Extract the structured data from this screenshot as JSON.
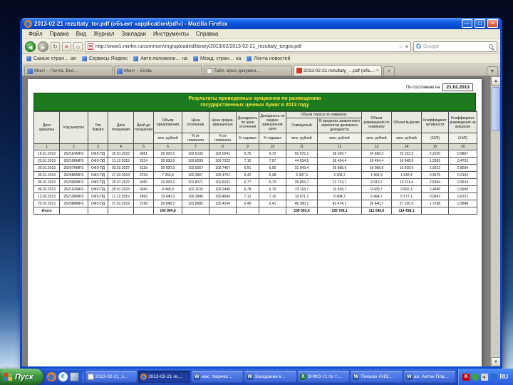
{
  "accent_colors": {
    "banner_green": "#1d7a1f",
    "banner_text_yellow": "#ffe93e",
    "xp_taskbar_blue": "#2a5ade",
    "start_button_green": "#3c9a3c",
    "titlebar_blue": "#0a50d8"
  },
  "icons": {
    "back": "◀",
    "forward": "▶",
    "reload": "↻",
    "stop": "×",
    "home": "⌂",
    "dropdown": "▾",
    "star": "☆",
    "close_tab": "×",
    "new_tab": "+",
    "scroll_up": "▲",
    "scroll_down": "▼"
  },
  "window": {
    "title": "2013-02-21 rezultaty_tor.pdf (объект «application/pdf») - Mozilla Firefox",
    "controls": {
      "minimize": "—",
      "restore": "□",
      "close": "×"
    },
    "menu": [
      "Файл",
      "Правка",
      "Вид",
      "Журнал",
      "Закладки",
      "Инструменты",
      "Справка"
    ],
    "nav": {
      "url": "http://www1.minfin.ru/common/img/uploaded/library/2013/02/2013-02-21_rezultaty_torgov.pdf",
      "search_engine_letter": "G",
      "search_label": "Google"
    },
    "bookmarks": [
      {
        "label": "Самые стран… ая"
      },
      {
        "label": "Сервисы Яндекс"
      },
      {
        "label": "Авто.положени… на"
      },
      {
        "label": "Межд. стран… на"
      },
      {
        "label": "Лента новостей"
      }
    ],
    "tabs": [
      {
        "icon": "site-icon",
        "label": "Минт – Почта. Вхо…"
      },
      {
        "icon": "site-icon",
        "label": "Минт – Elista"
      },
      {
        "icon": "doc-icon",
        "label": "Табл. врио докумен…"
      },
      {
        "icon": "pdf-icon",
        "label": "2013-02-21 rezultaty_…pdf (объ…",
        "active": true
      }
    ]
  },
  "document": {
    "asof_label": "По состоянию на",
    "asof_date": "21.02.2013",
    "title_line1": "Результаты проведенных аукционов по размещению",
    "title_line2": "государственных ценных бумаг в 2013 году",
    "table": {
      "headers": [
        "Дата аукциона",
        "Код выпуска",
        "Тип бумаги",
        "Дата погашения",
        "Дней до погашения",
        "Объем предложения",
        "Цена отсечения",
        "Цена средне-взвешенная",
        "Доходность по цене отсечения",
        "Доходность по средне-взвешенной цене"
      ],
      "demand_group": "Объем спроса по номиналу",
      "demand_subs": [
        "Совокупный",
        "В пределах заявленного эмитентом диапазона доходности"
      ],
      "headers2": [
        "Объем размещения по номиналу",
        "Объем выручки",
        "Коэффициент активности",
        "Коэффициент размещения на аукционе"
      ],
      "units": [
        "млн. рублей",
        "% от номинала",
        "% от номинала",
        "% годовых",
        "% годовых",
        "млн. рублей",
        "млн. рублей",
        "млн. рублей",
        "млн. рублей",
        "(12/6)",
        "(14/6)"
      ],
      "col_numbers": [
        "1",
        "2",
        "3",
        "4",
        "5",
        "6",
        "7",
        "8",
        "9",
        "10",
        "11",
        "12",
        "13",
        "14",
        "15",
        "16"
      ],
      "rows": [
        [
          "16.01.2013",
          "26211RMFS",
          "ОФЗ-ПД",
          "25.01.2023",
          "3661",
          "25 000,0",
          "102,5109",
          "102,5541",
          "6,75",
          "6,72",
          "55 575,1",
          "38 599,7",
          "24 668,3",
          "25 323,5",
          "2,2230",
          "0,9867"
        ],
        [
          "23.01.2013",
          "26210RMFS",
          "ОФЗ-ПД",
          "11.12.2019",
          "2514",
          "35 000,0",
          "100,6039",
          "100,7222",
          "7,10",
          "7,07",
          "44 034,5",
          "36 454,4",
          "16 454,4",
          "16 848,6",
          "1,2581",
          "0,4701"
        ],
        [
          "30.01.2013",
          "26207RMFS",
          "ОФЗ-ПД",
          "03.02.2027",
          "5118",
          "20 000,0",
          "102,5557",
          "102,7457",
          "6,91",
          "6,90",
          "31 043,4",
          "26 868,6",
          "16 068,6",
          "16 818,0",
          "1,5522",
          "0,8034"
        ],
        [
          "30.01.2013",
          "26208RMFS",
          "ОФЗ-ПД",
          "27.02.2019",
          "2219",
          "7 266,8",
          "102,3557",
          "102,4761",
          "6,42",
          "6,38",
          "3 397,0",
          "3 304,2",
          "1 564,9",
          "1 642,4",
          "0,4675",
          "0,2154"
        ],
        [
          "06.02.2013",
          "26209RMFS",
          "ОФЗ-ПД",
          "20.07.2022",
          "3450",
          "10 000,0",
          "101,8271",
          "101,9101",
          "6,77",
          "6,76",
          "25 963,7",
          "21 713,7",
          "9 913,7",
          "10 211,4",
          "2,5964",
          "0,9914"
        ],
        [
          "06.02.2013",
          "26211RMFS",
          "ОФЗ-ПД",
          "25.01.2023",
          "3640",
          "9 440,0",
          "102,1100",
          "102,2445",
          "6,78",
          "6,76",
          "23 118,7",
          "16 818,7",
          "9 439,7",
          "9 697,1",
          "2,4490",
          "0,9999"
        ],
        [
          "13.02.2013",
          "26210RMFS",
          "ОФЗ-ПД",
          "11.12.2019",
          "2493",
          "10 440,0",
          "100,3940",
          "100,4664",
          "7,12",
          "7,10",
          "10 071,1",
          "8 494,7",
          "6 494,7",
          "6 577,1",
          "0,9647",
          "0,6221"
        ],
        [
          "20.02.2013",
          "26208RMFS",
          "ОФЗ-ПД",
          "27.02.2019",
          "2198",
          "26 848,0",
          "101,8985",
          "102,4104",
          "6,45",
          "6,41",
          "46 360,1",
          "43 474,1",
          "26 440,7",
          "27 320,0",
          "1,7268",
          "0,9848"
        ]
      ],
      "total_row": [
        "Итого",
        "",
        "",
        "",
        "",
        "143 994,8",
        "",
        "",
        "",
        "",
        "239 563,6",
        "195 728,1",
        "111 045,0",
        "114 438,1",
        "",
        ""
      ]
    }
  },
  "taskbar": {
    "start_label": "Пуск",
    "quick_launch": [
      "firefox-icon",
      "ie-icon",
      "show-desktop-icon"
    ],
    "buttons": [
      {
        "icon": "doc-icon",
        "label": "2013-02-21_з…"
      },
      {
        "icon": "firefox-icon",
        "label": "2013-02-21 re…",
        "active": true
      },
      {
        "icon": "word-icon",
        "label": "нак. творчес…"
      },
      {
        "icon": "word-icon",
        "label": "Заседание к…"
      },
      {
        "icon": "excel-icon",
        "label": "ЗНФО-т1 по т…"
      },
      {
        "icon": "word-icon",
        "label": "Письмо АНЭ…"
      },
      {
        "icon": "word-icon",
        "label": "ав. Антон Пла…"
      }
    ],
    "tray_icons": [
      "kaspersky-icon",
      "shield-icon",
      "speaker-icon",
      "network-icon"
    ],
    "language": "RU"
  }
}
